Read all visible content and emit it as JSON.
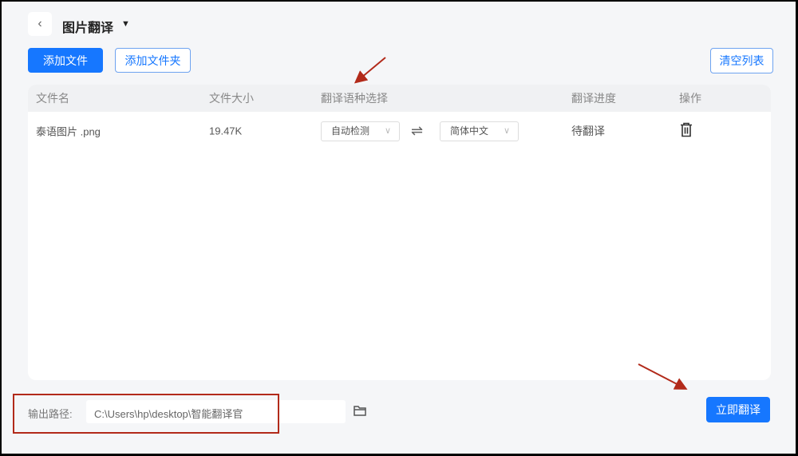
{
  "header": {
    "back_icon": "chevron-left-icon",
    "title": "图片翻译",
    "dropdown_icon": "caret-down-icon"
  },
  "toolbar": {
    "add_file": "添加文件",
    "add_folder": "添加文件夹",
    "clear_list": "清空列表"
  },
  "table": {
    "columns": [
      "文件名",
      "文件大小",
      "翻译语种选择",
      "翻译进度",
      "操作"
    ],
    "rows": [
      {
        "name": "泰语图片 .png",
        "size": "19.47K",
        "source_lang": "自动检测",
        "target_lang": "简体中文",
        "status": "待翻译"
      }
    ]
  },
  "footer": {
    "output_label": "输出路径:",
    "output_path": "C:\\Users\\hp\\desktop\\智能翻译官",
    "translate_button": "立即翻译"
  },
  "colors": {
    "accent": "#1677ff",
    "annotation": "#b22a1a"
  }
}
